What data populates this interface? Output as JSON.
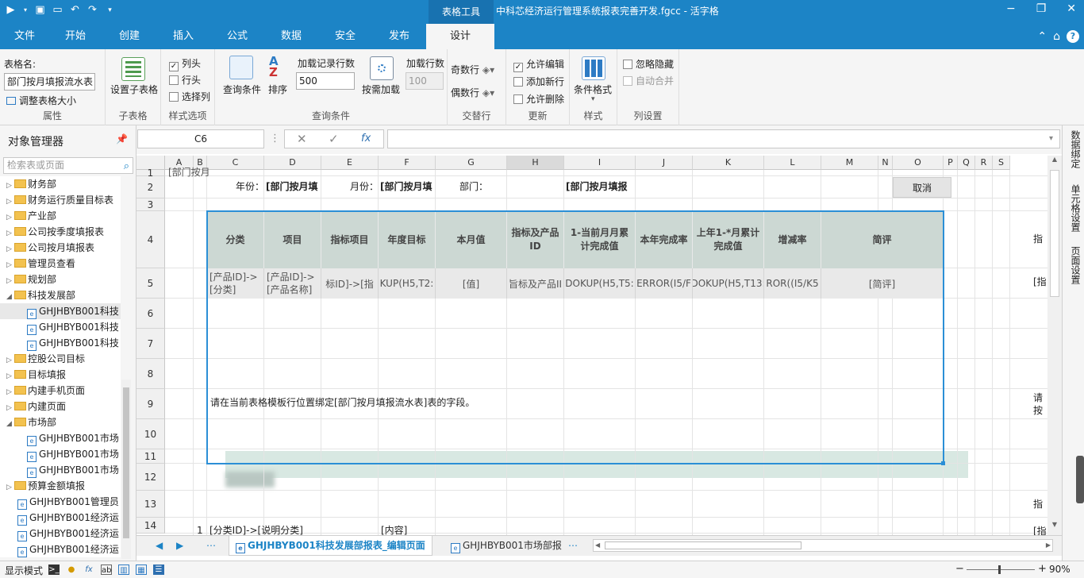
{
  "window": {
    "context_tab": "表格工具",
    "title": "中科芯经济运行管理系统报表完善开发.fgcc - 活字格"
  },
  "ribbon_tabs": [
    "文件",
    "开始",
    "创建",
    "插入",
    "公式",
    "数据",
    "安全",
    "发布",
    "设计"
  ],
  "active_tab": "设计",
  "ribbon": {
    "table_name_label": "表格名:",
    "table_name_value": "部门按月填报流水表",
    "resize_table": "调整表格大小",
    "group_properties": "属性",
    "set_subtable": "设置子表格",
    "group_subtable": "子表格",
    "col_header": "列头",
    "row_header": "行头",
    "select_col": "选择列",
    "group_table_options": "样式选项",
    "query_condition": "查询条件",
    "sort": "排序",
    "load_rows_label": "加载记录行数",
    "load_rows_value": "500",
    "load_on_demand": "按需加载",
    "load_rows2_label": "加载行数",
    "load_rows2_value": "100",
    "group_query": "查询条件",
    "odd_row": "奇数行",
    "even_row": "偶数行",
    "group_alternate": "交替行",
    "allow_edit": "允许编辑",
    "add_new_row": "添加新行",
    "allow_delete": "允许删除",
    "group_update": "更新",
    "conditional_format": "条件格式",
    "group_style": "样式",
    "ignore_hidden": "忽略隐藏",
    "auto_merge": "自动合并",
    "group_col_settings": "列设置"
  },
  "object_manager": {
    "title": "对象管理器",
    "search_placeholder": "检索表或页面",
    "items": [
      {
        "label": "财务部",
        "type": "folder",
        "expanded": false
      },
      {
        "label": "财务运行质量目标表",
        "type": "folder",
        "expanded": false
      },
      {
        "label": "产业部",
        "type": "folder",
        "expanded": false
      },
      {
        "label": "公司按季度填报表",
        "type": "folder",
        "expanded": false
      },
      {
        "label": "公司按月填报表",
        "type": "folder",
        "expanded": false
      },
      {
        "label": "管理员查看",
        "type": "folder",
        "expanded": false
      },
      {
        "label": "规划部",
        "type": "folder",
        "expanded": false
      },
      {
        "label": "科技发展部",
        "type": "folder",
        "expanded": true
      },
      {
        "label": "GHJHBYB001科技",
        "type": "page",
        "selected": true
      },
      {
        "label": "GHJHBYB001科技",
        "type": "page"
      },
      {
        "label": "GHJHBYB001科技",
        "type": "page"
      },
      {
        "label": "控股公司目标",
        "type": "folder",
        "expanded": false
      },
      {
        "label": "目标填报",
        "type": "folder",
        "expanded": false
      },
      {
        "label": "内建手机页面",
        "type": "folder",
        "expanded": false
      },
      {
        "label": "内建页面",
        "type": "folder",
        "expanded": false
      },
      {
        "label": "市场部",
        "type": "folder",
        "expanded": true
      },
      {
        "label": "GHJHBYB001市场",
        "type": "page"
      },
      {
        "label": "GHJHBYB001市场",
        "type": "page"
      },
      {
        "label": "GHJHBYB001市场",
        "type": "page"
      },
      {
        "label": "预算金额填报",
        "type": "folder",
        "expanded": false
      },
      {
        "label": "GHJHBYB001管理员",
        "type": "page"
      },
      {
        "label": "GHJHBYB001经济运",
        "type": "page"
      },
      {
        "label": "GHJHBYB001经济运",
        "type": "page"
      },
      {
        "label": "GHJHBYB001经济运",
        "type": "page"
      }
    ]
  },
  "formula_bar": {
    "name_box": "C6",
    "cancel": "✕",
    "confirm": "✓",
    "fx": "fx",
    "formula": ""
  },
  "right_panel": [
    "数据绑定",
    "单元格设置",
    "页面设置"
  ],
  "sheet": {
    "columns": [
      "A",
      "B",
      "C",
      "D",
      "E",
      "F",
      "G",
      "H",
      "I",
      "J",
      "K",
      "L",
      "M",
      "N",
      "O",
      "P",
      "Q",
      "R",
      "S"
    ],
    "selected_column": "H",
    "rows": [
      "1",
      "2",
      "3",
      "4",
      "5",
      "6",
      "7",
      "8",
      "9",
      "10",
      "11",
      "12",
      "13",
      "14"
    ],
    "row1_partial": "[部门按月",
    "row2": {
      "year_label": "年份：",
      "year_value": "[部门按月填",
      "month_label": "月份：",
      "month_value": "[部门按月填",
      "dept_label": "部门：",
      "dept_value": "[部门按月填报",
      "cancel_button": "取消"
    },
    "header_row": [
      "分类",
      "项目",
      "指标项目",
      "年度目标",
      "本月值",
      "指标及产品ID",
      "1-当前月月累计完成值",
      "本年完成率",
      "上年1-*月累计完成值",
      "增减率",
      "简评"
    ],
    "template_row": [
      "[产品ID]->[分类]",
      "[产品ID]->[产品名称]",
      "标ID]->[指",
      "KUP(H5,T2:",
      "[值]",
      "旨标及产品II",
      "DOKUP(H5,T5:",
      "ERROR(I5/F",
      "DOKUP(H5,T13:",
      "ROR((I5/K5",
      "[简评]"
    ],
    "hint": "请在当前表格模板行位置绑定[部门按月填报流水表]表的字段。",
    "right_clip_4": "指",
    "right_clip_5": "[指",
    "right_clip_8": "请",
    "right_clip_8b": "按",
    "right_clip_12": "指",
    "right_clip_13": "[指",
    "row13": {
      "a": "1",
      "c": "[分类ID]->[说明分类]",
      "f": "[内容]"
    }
  },
  "sheet_tabs": {
    "active": "GHJHBYB001科技发展部报表_编辑页面",
    "other": "GHJHBYB001市场部报",
    "more": "..."
  },
  "status": {
    "mode": "显示模式",
    "zoom": "90%",
    "zoom_fraction": 0.9
  },
  "colors": {
    "brand": "#1c84c6",
    "header_fill": "#ccd8d3",
    "row12_fill": "#d8e8e2",
    "selection": "#2b8fd6"
  }
}
